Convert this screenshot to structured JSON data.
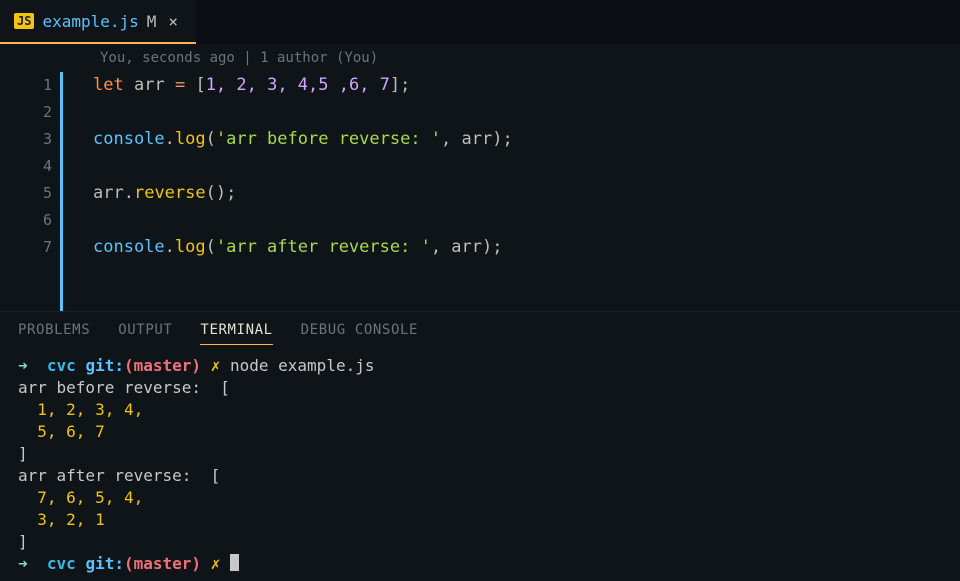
{
  "tab": {
    "lang_badge": "JS",
    "filename": "example.js",
    "modified_indicator": "M",
    "close_glyph": "×"
  },
  "codelens": "You, seconds ago | 1 author (You)",
  "lines": {
    "n1": "1",
    "n2": "2",
    "n3": "3",
    "n4": "4",
    "n5": "5",
    "n6": "6",
    "n7": "7"
  },
  "code": {
    "l1": {
      "let": "let",
      "arr": "arr",
      "eq": "=",
      "open": "[",
      "vals": "1, 2, 3, 4,5 ,6, 7",
      "close": "];"
    },
    "l3": {
      "console": "console",
      "dot": ".",
      "log": "log",
      "open": "(",
      "str": "'arr before reverse: '",
      "comma": ", ",
      "arr": "arr",
      "close": ");"
    },
    "l5": {
      "arr": "arr",
      "dot": ".",
      "rev": "reverse",
      "paren": "();"
    },
    "l7": {
      "console": "console",
      "dot": ".",
      "log": "log",
      "open": "(",
      "str": "'arr after reverse: '",
      "comma": ", ",
      "arr": "arr",
      "close": ");"
    }
  },
  "panel_tabs": {
    "problems": "PROBLEMS",
    "output": "OUTPUT",
    "terminal": "TERMINAL",
    "debug": "DEBUG CONSOLE"
  },
  "term": {
    "arrow": "➜",
    "cvc": "cvc",
    "git": "git:",
    "lp": "(",
    "branch": "master",
    "rp": ")",
    "x": "✗",
    "cmd1": "node example.js",
    "out1": "arr before reverse:  [",
    "out2": "  1, 2, 3, 4,",
    "out3": "  5, 6, 7",
    "out4": "]",
    "out5": "arr after reverse:  [",
    "out6": "  7, 6, 5, 4,",
    "out7": "  3, 2, 1",
    "out8": "]"
  }
}
